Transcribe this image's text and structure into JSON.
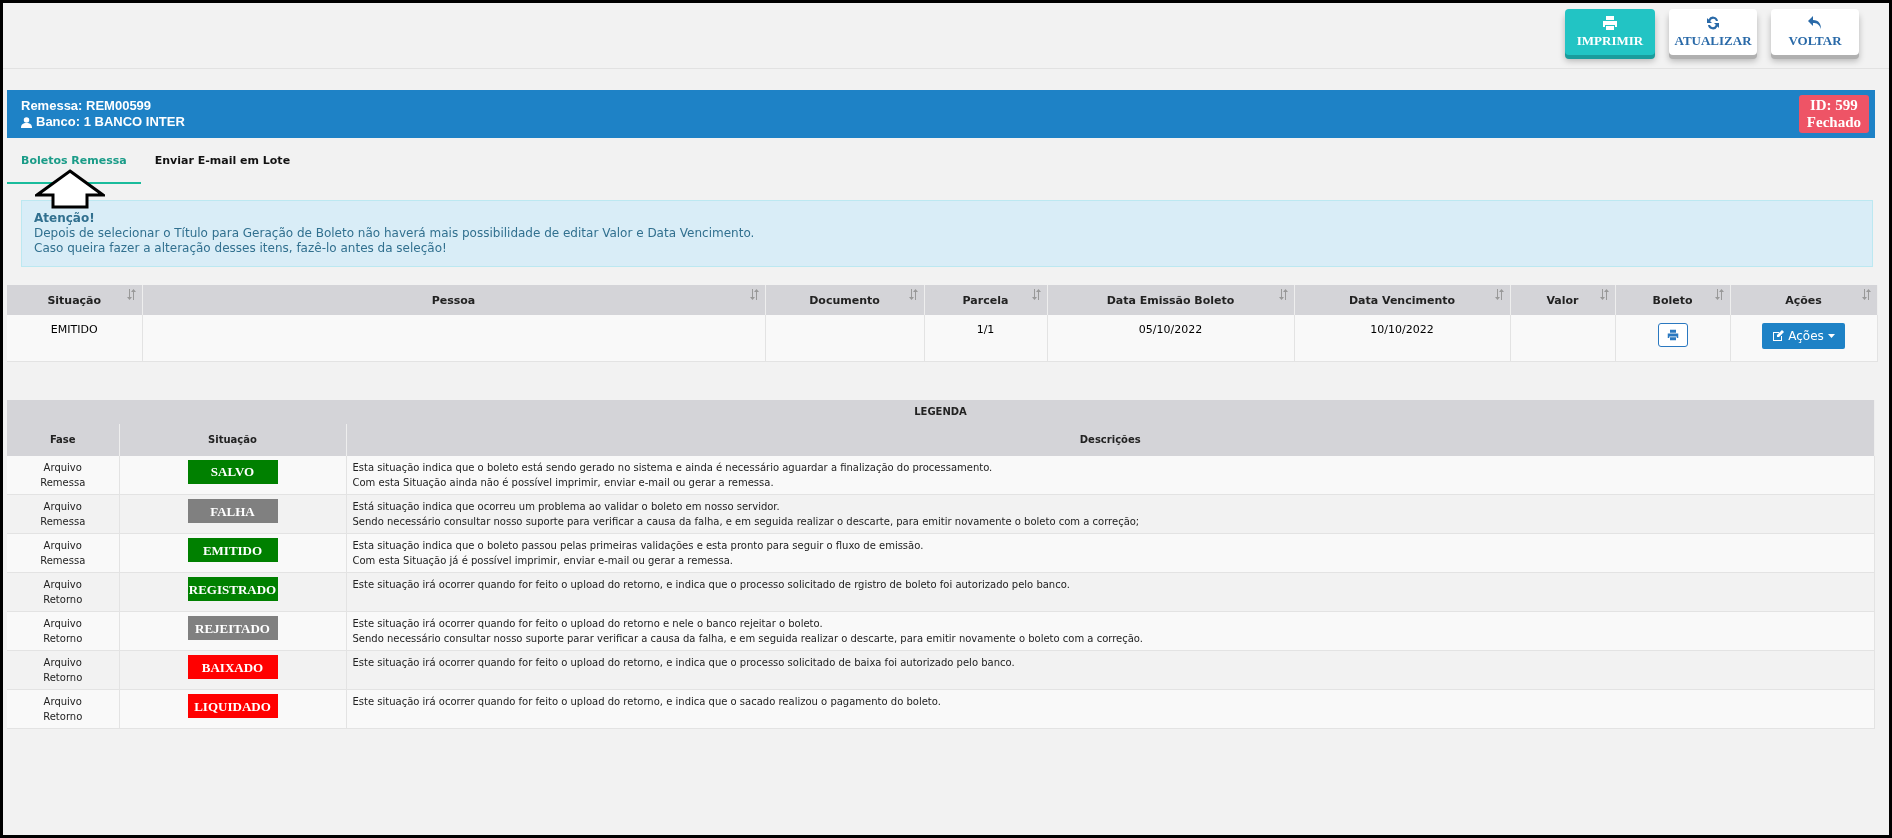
{
  "toolbar": [
    {
      "kind": "print",
      "label": "IMPRIMIR",
      "primary": true
    },
    {
      "kind": "refresh",
      "label": "ATUALIZAR",
      "primary": false
    },
    {
      "kind": "back",
      "label": "VOLTAR",
      "primary": false
    }
  ],
  "header": {
    "remessa": "Remessa: REM00599",
    "banco": "Banco: 1 BANCO INTER",
    "badge_id": "ID: 599",
    "badge_status": "Fechado"
  },
  "tabs": [
    {
      "label": "Boletos Remessa",
      "selected": true
    },
    {
      "label": "Enviar E-mail em Lote",
      "selected": false
    }
  ],
  "alert": {
    "title": "Atenção!",
    "lines": [
      "Depois de selecionar o Título para Geração de Boleto não haverá mais possibilidade de editar Valor e Data Vencimento.",
      "Caso queira fazer a alteração desses itens, fazê-lo antes da seleção!"
    ]
  },
  "table": {
    "columns": [
      "Situação",
      "Pessoa",
      "Documento",
      "Parcela",
      "Data Emissão Boleto",
      "Data Vencimento",
      "Valor",
      "Boleto",
      "Ações"
    ],
    "rows": [
      {
        "cells": [
          {
            "kind": "text",
            "text": "EMITIDO"
          },
          {
            "kind": "empty"
          },
          {
            "kind": "empty"
          },
          {
            "kind": "text",
            "text": "1/1"
          },
          {
            "kind": "text",
            "text": "05/10/2022"
          },
          {
            "kind": "text",
            "text": "10/10/2022"
          },
          {
            "kind": "empty"
          },
          {
            "kind": "print"
          },
          {
            "kind": "actions",
            "text": "Ações"
          }
        ]
      }
    ]
  },
  "legend": {
    "title": "LEGENDA",
    "columns": [
      "Fase",
      "Situação",
      "Descrições"
    ],
    "rows": [
      {
        "fase": [
          "Arquivo",
          "Remessa"
        ],
        "status": "SALVO",
        "color": "#008000",
        "description": [
          "Esta situação indica que o boleto está sendo gerado no sistema e ainda é necessário aguardar a finalização do processamento.",
          "Com esta Situação ainda não é possível imprimir, enviar e-mail ou gerar a remessa."
        ]
      },
      {
        "fase": [
          "Arquivo",
          "Remessa"
        ],
        "status": "FALHA",
        "color": "#808080",
        "description": [
          "Está situação indica que ocorreu um problema ao validar o boleto em nosso servidor.",
          "Sendo necessário consultar nosso suporte para verificar a causa da falha, e em seguida realizar o descarte, para emitir novamente o boleto com a correção;"
        ]
      },
      {
        "fase": [
          "Arquivo",
          "Remessa"
        ],
        "status": "EMITIDO",
        "color": "#008000",
        "description": [
          "Esta situação indica que o boleto passou pelas primeiras validações e esta pronto para seguir o fluxo de emissão.",
          "Com esta Situação já é possível imprimir, enviar e-mail ou gerar a remessa."
        ]
      },
      {
        "fase": [
          "Arquivo",
          "Retorno"
        ],
        "status": "REGISTRADO",
        "color": "#008000",
        "description": [
          "Este situação irá ocorrer quando for feito o upload do retorno, e indica que o processo solicitado de rgistro de boleto foi autorizado pelo banco."
        ]
      },
      {
        "fase": [
          "Arquivo",
          "Retorno"
        ],
        "status": "REJEITADO",
        "color": "#808080",
        "description": [
          "Este situação irá ocorrer quando for feito o upload do retorno e nele o banco rejeitar o boleto.",
          "Sendo necessário consultar nosso suporte parar verificar a causa da falha, e em seguida realizar o descarte, para emitir novamente o boleto com a correção."
        ]
      },
      {
        "fase": [
          "Arquivo",
          "Retorno"
        ],
        "status": "BAIXADO",
        "color": "#ff0000",
        "description": [
          "Este situação irá ocorrer quando for feito o upload do retorno, e indica que o processo solicitado de baixa foi autorizado pelo banco."
        ]
      },
      {
        "fase": [
          "Arquivo",
          "Retorno"
        ],
        "status": "LIQUIDADO",
        "color": "#ff0000",
        "description": [
          "Este situação irá ocorrer quando for feito o upload do retorno, e indica que o sacado realizou o pagamento do boleto."
        ]
      }
    ]
  }
}
